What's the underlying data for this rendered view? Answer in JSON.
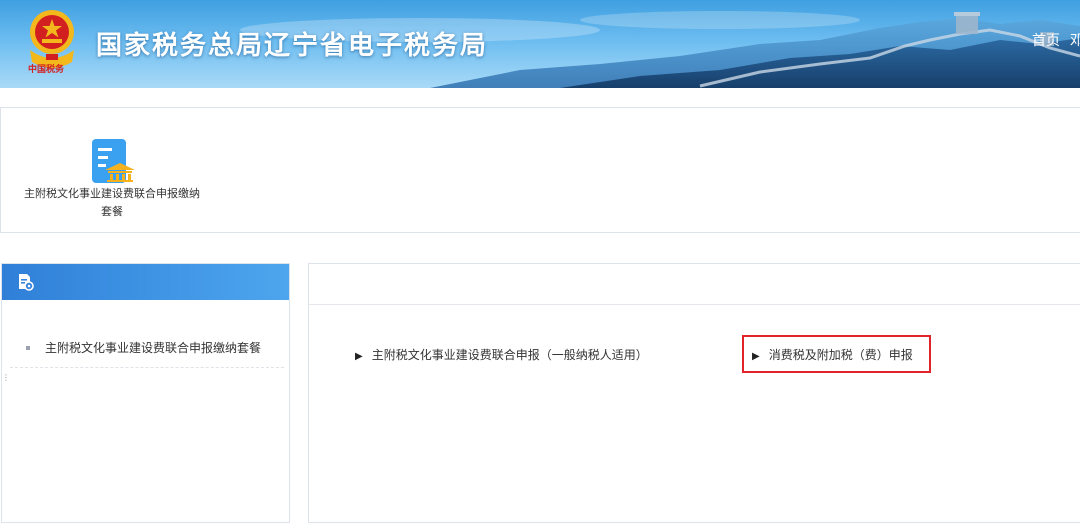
{
  "header": {
    "title": "国家税务总局辽宁省电子税务局",
    "emblem_caption": "中国税务",
    "nav": {
      "home": "首页",
      "next_partial": "邓"
    },
    "colors": {
      "sky_top": "#3f9fe0",
      "sky_bottom": "#a9daf7",
      "emblem_red": "#d21f1f",
      "emblem_gold": "#f2b81c"
    },
    "icons": [
      "national-emblem-icon"
    ]
  },
  "package_section": {
    "card": {
      "icon": "document-bank-icon",
      "label_line1": "主附税文化事业建设费联合申报缴纳",
      "label_line2": "套餐"
    }
  },
  "sidebar": {
    "header_icon": "document-settings-icon",
    "header_color": "#3585de",
    "items": [
      {
        "label": "主附税文化事业建设费联合申报缴纳套餐"
      }
    ]
  },
  "main": {
    "links": [
      {
        "label": "主附税文化事业建设费联合申报（一般纳税人适用）",
        "highlighted": false
      },
      {
        "label": "消费税及附加税（费）申报",
        "highlighted": true
      }
    ],
    "highlight_color": "#e0242a"
  }
}
